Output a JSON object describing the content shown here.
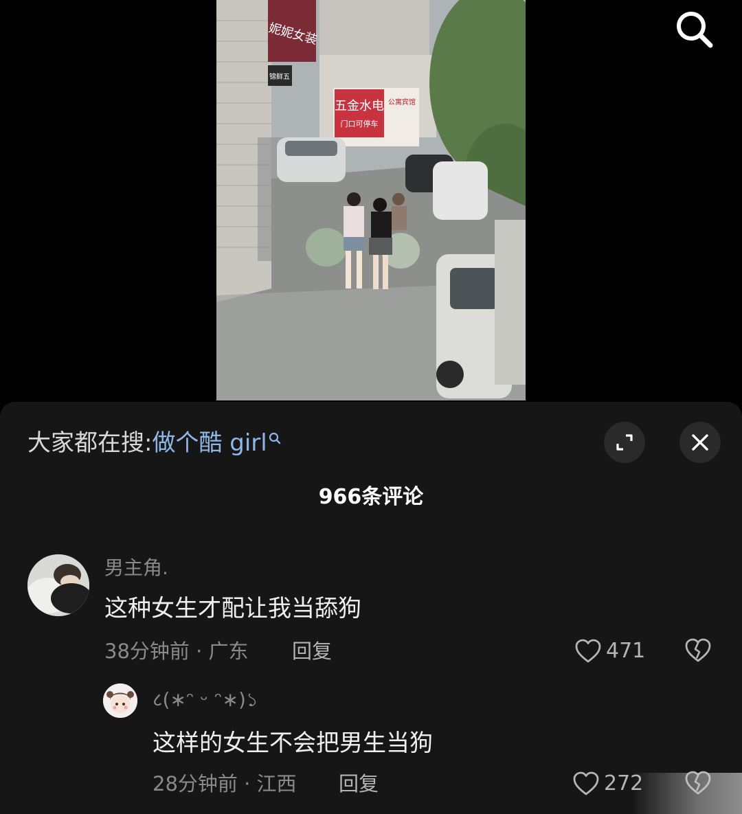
{
  "video": {
    "signs": {
      "shop_top": "妮妮女装",
      "shop_small": "锦鲜五",
      "hardware_main": "五金水电",
      "hardware_sub": "门口可停车",
      "hardware_right": "公寓宾馆"
    }
  },
  "top_bar": {
    "search_icon": "search-icon"
  },
  "hot_search": {
    "prefix": "大家都在搜:",
    "query": "做个酷 girl",
    "icon": "mini-search-icon"
  },
  "buttons": {
    "expand_icon": "expand-icon",
    "close_icon": "close-icon"
  },
  "comments": {
    "count_label": "966条评论",
    "items": [
      {
        "username": "男主角.",
        "text": "这种女生才配让我当舔狗",
        "time": "38分钟前",
        "location": "广东",
        "meta": "38分钟前 · 广东",
        "reply_label": "回复",
        "likes": "471"
      },
      {
        "username": "८(∗ᵔ ᵕ ᵔ∗)১",
        "text": "这样的女生不会把男生当狗",
        "time": "28分钟前",
        "location": "江西",
        "meta": "28分钟前 · 江西",
        "reply_label": "回复",
        "likes": "272"
      }
    ]
  },
  "colors": {
    "sheet_bg": "#161616",
    "hot_search_query": "#8fb6e8",
    "muted_text": "#8a8a8a",
    "button_bg": "#2a2a2a"
  }
}
